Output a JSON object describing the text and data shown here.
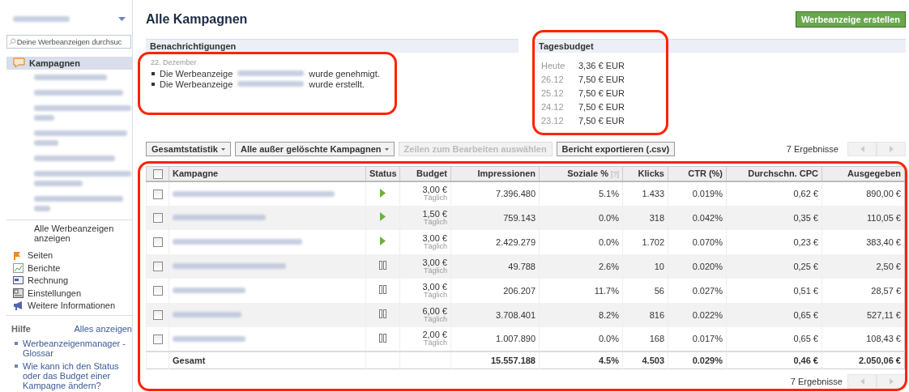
{
  "sidebar": {
    "account": {
      "kind": "redacted"
    },
    "search": {
      "placeholder": "Deine Werbeanzeigen durchsuc"
    },
    "campaigns_header": {
      "label": "Kampagnen",
      "selected": true
    },
    "campaigns": [
      {
        "kind": "redacted"
      },
      {
        "kind": "redacted"
      },
      {
        "kind": "redacted"
      },
      {
        "kind": "redacted"
      },
      {
        "kind": "redacted"
      },
      {
        "kind": "redacted"
      },
      {
        "kind": "redacted"
      }
    ],
    "all_ads_link": "Alle Werbeanzeigen anzeigen",
    "nav": [
      {
        "label": "Seiten",
        "kind": "pages"
      },
      {
        "label": "Berichte",
        "kind": "reports"
      },
      {
        "label": "Rechnung",
        "kind": "billing"
      },
      {
        "label": "Einstellungen",
        "kind": "settings"
      },
      {
        "label": "Weitere Informationen",
        "kind": "info"
      }
    ],
    "help": {
      "title": "Hilfe",
      "see_all": "Alles anzeigen",
      "links": [
        "Werbeanzeigenmanager - Glossar",
        "Wie kann ich den Status oder das Budget einer Kampagne ändern?"
      ]
    }
  },
  "page_title": "Alle Kampagnen",
  "create_button": "Werbeanzeige erstellen",
  "notifications": {
    "title": "Benachrichtigungen",
    "date": "22. Dezember",
    "items": [
      {
        "prefix": "Die Werbeanzeige",
        "suffix": "wurde genehmigt."
      },
      {
        "prefix": "Die Werbeanzeige",
        "suffix": "wurde erstellt."
      }
    ]
  },
  "daily_budget": {
    "title": "Tagesbudget",
    "rows": [
      {
        "day": "Heute",
        "amount": "3,36 € EUR"
      },
      {
        "day": "26.12",
        "amount": "7,50 € EUR"
      },
      {
        "day": "25.12",
        "amount": "7,50 € EUR"
      },
      {
        "day": "24.12",
        "amount": "7,50 € EUR"
      },
      {
        "day": "23.12",
        "amount": "7,50 € EUR"
      }
    ]
  },
  "toolbar": {
    "buttons": [
      {
        "label": "Gesamtstatistik",
        "dropdown": true,
        "disabled": false
      },
      {
        "label": "Alle außer gelöschte Kampagnen",
        "dropdown": true,
        "disabled": false
      },
      {
        "label": "Zeilen zum Bearbeiten auswählen",
        "dropdown": false,
        "disabled": true
      },
      {
        "label": "Bericht exportieren (.csv)",
        "dropdown": false,
        "disabled": false
      }
    ],
    "results": "7 Ergebnisse"
  },
  "table": {
    "select_all": {
      "checked": false
    },
    "columns": [
      {
        "label": "Kampagne"
      },
      {
        "label": "Status"
      },
      {
        "label": "Budget"
      },
      {
        "label": "Impressionen"
      },
      {
        "label": "Soziale %",
        "hint": "[?]"
      },
      {
        "label": "Klicks"
      },
      {
        "label": "CTR (%)"
      },
      {
        "label": "Durchschn. CPC"
      },
      {
        "label": "Ausgegeben"
      }
    ],
    "rows": [
      {
        "checked": false,
        "active": true,
        "budget": "3,00 €",
        "period": "Täglich",
        "impressions": "7.396.480",
        "social": "5.1%",
        "clicks": "1.433",
        "ctr": "0.019%",
        "cpc": "0,62 €",
        "spent": "890,00 €"
      },
      {
        "checked": false,
        "active": true,
        "budget": "1,50 €",
        "period": "Täglich",
        "impressions": "759.143",
        "social": "0.0%",
        "clicks": "318",
        "ctr": "0.042%",
        "cpc": "0,35 €",
        "spent": "110,05 €"
      },
      {
        "checked": false,
        "active": true,
        "budget": "3,00 €",
        "period": "Täglich",
        "impressions": "2.429.279",
        "social": "0.0%",
        "clicks": "1.702",
        "ctr": "0.070%",
        "cpc": "0,23 €",
        "spent": "383,40 €"
      },
      {
        "checked": false,
        "active": false,
        "budget": "3,00 €",
        "period": "Täglich",
        "impressions": "49.788",
        "social": "2.6%",
        "clicks": "10",
        "ctr": "0.020%",
        "cpc": "0,25 €",
        "spent": "2,50 €"
      },
      {
        "checked": false,
        "active": false,
        "budget": "3,00 €",
        "period": "Täglich",
        "impressions": "206.207",
        "social": "11.7%",
        "clicks": "56",
        "ctr": "0.027%",
        "cpc": "0,51 €",
        "spent": "28,57 €"
      },
      {
        "checked": false,
        "active": false,
        "budget": "6,00 €",
        "period": "Täglich",
        "impressions": "3.708.401",
        "social": "8.2%",
        "clicks": "816",
        "ctr": "0.022%",
        "cpc": "0,65 €",
        "spent": "527,11 €"
      },
      {
        "checked": false,
        "active": false,
        "budget": "2,00 €",
        "period": "Täglich",
        "impressions": "1.007.890",
        "social": "0.0%",
        "clicks": "168",
        "ctr": "0.017%",
        "cpc": "0,65 €",
        "spent": "108,43 €"
      }
    ],
    "total": {
      "label": "Gesamt",
      "impressions": "15.557.188",
      "social": "4.5%",
      "clicks": "4.503",
      "ctr": "0.029%",
      "cpc": "0,46 €",
      "spent": "2.050,06 €"
    }
  },
  "footer": {
    "results": "7 Ergebnisse"
  }
}
